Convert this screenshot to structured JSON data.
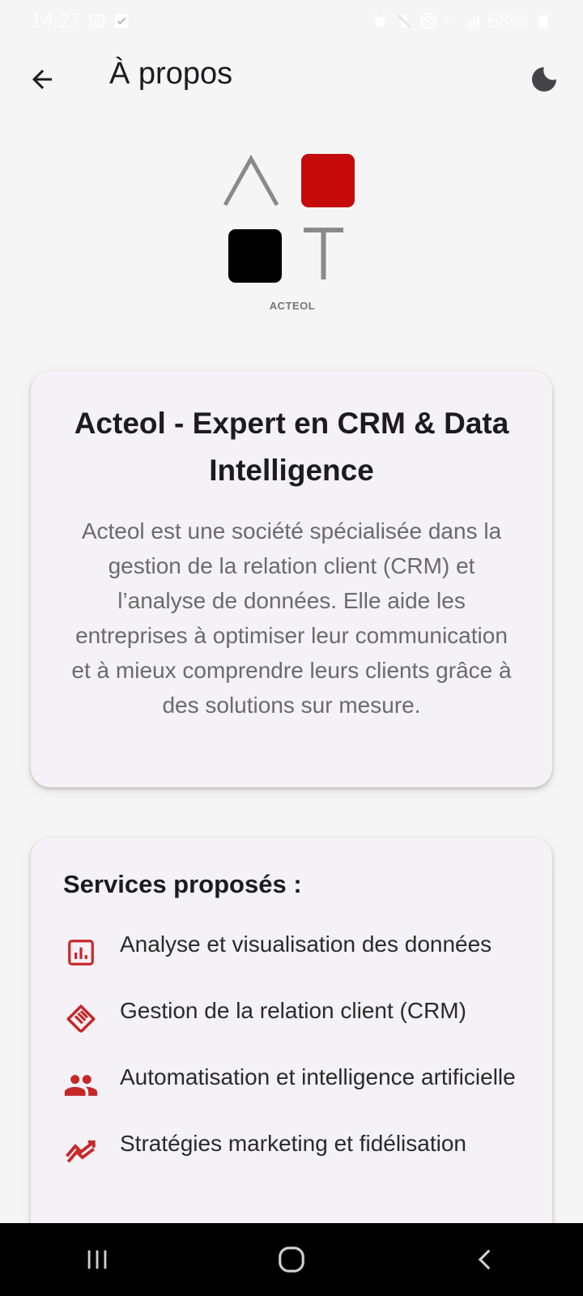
{
  "status_bar": {
    "time": "14:27",
    "battery": "68%",
    "network": "4G"
  },
  "app_bar": {
    "title": "À propos"
  },
  "logo": {
    "caption": "ACTEOL",
    "colors": {
      "red": "#c40a0a",
      "black": "#000000",
      "gray": "#8a8a8a"
    }
  },
  "about": {
    "title": "Acteol - Expert en CRM & Data Intelligence",
    "description": "Acteol est une société spécialisée dans la gestion de la relation client (CRM) et l’analyse de données. Elle aide les entreprises à optimiser leur communication et à mieux comprendre leurs clients grâce à des solutions sur mesure."
  },
  "services": {
    "title": "Services proposés :",
    "items": [
      {
        "label": "Analyse et visualisation des données",
        "icon": "analytics-icon"
      },
      {
        "label": "Gestion de la relation client (CRM)",
        "icon": "handshake-icon"
      },
      {
        "label": "Automatisation et intelligence artificielle",
        "icon": "people-icon"
      },
      {
        "label": "Stratégies marketing et fidélisation",
        "icon": "trending-down-icon"
      }
    ]
  },
  "theme": {
    "accent": "#c62828",
    "card_bg": "#f4f1f7",
    "page_bg": "#f5f5f5"
  }
}
